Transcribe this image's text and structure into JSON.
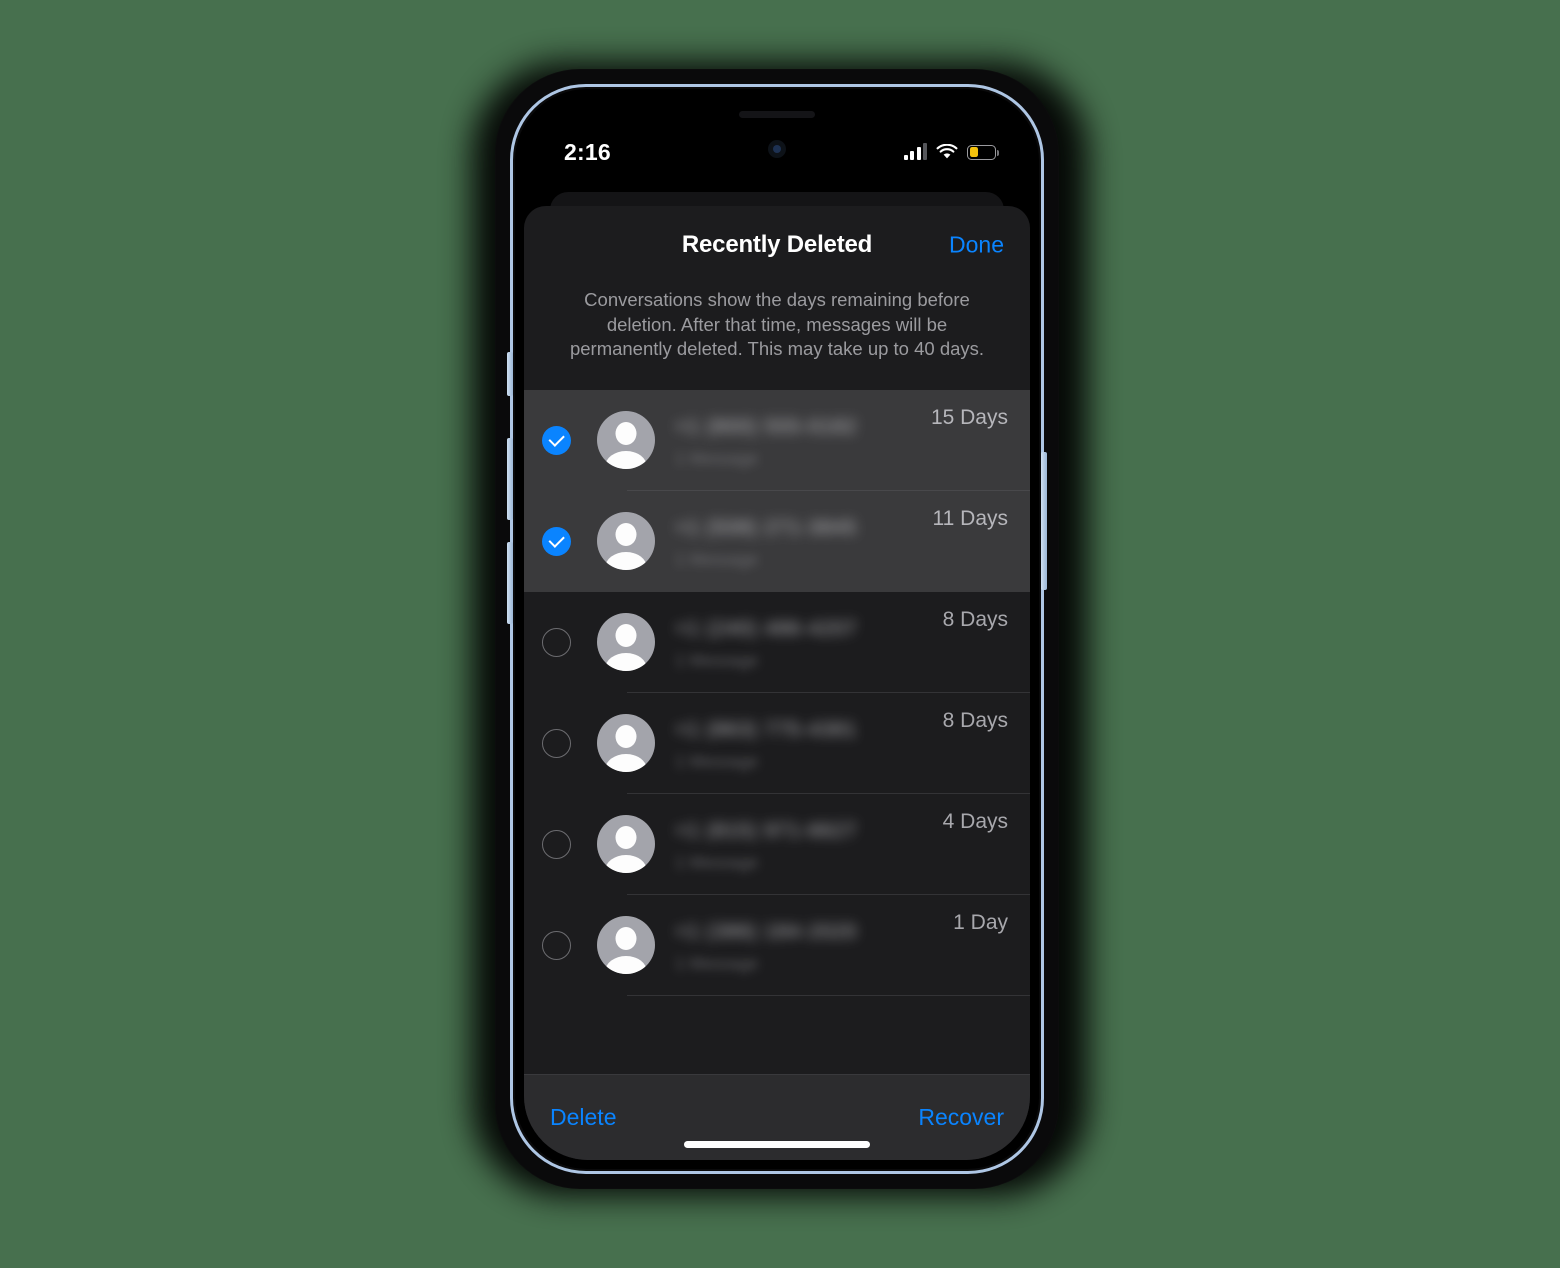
{
  "background_color": "#47704e",
  "accent_color": "#0a84ff",
  "device": {
    "frame_color": "#aec6e4",
    "buttons": [
      "mute-switch",
      "volume-up",
      "volume-down",
      "power"
    ]
  },
  "status_bar": {
    "time": "2:16",
    "signal_bars_filled": 3,
    "signal_bars_total": 4,
    "wifi": "wifi-icon",
    "battery_percent": 35,
    "battery_color": "#f4c20d"
  },
  "sheet": {
    "title": "Recently Deleted",
    "done_label": "Done",
    "description": "Conversations show the days remaining before deletion. After that time, messages will be permanently deleted. This may take up to 40 days."
  },
  "list": {
    "rows": [
      {
        "selected": true,
        "name": "+1 (800) 555-0182",
        "subtitle": "1 Message",
        "days": "15 Days"
      },
      {
        "selected": true,
        "name": "+1 (508) 271-3845",
        "subtitle": "1 Message",
        "days": "11 Days"
      },
      {
        "selected": false,
        "name": "+1 (240) 486-4207",
        "subtitle": "1 Message",
        "days": "8 Days"
      },
      {
        "selected": false,
        "name": "+1 (863) 775-4381",
        "subtitle": "1 Message",
        "days": "8 Days"
      },
      {
        "selected": false,
        "name": "+1 (815) 971-6627",
        "subtitle": "1 Message",
        "days": "4 Days"
      },
      {
        "selected": false,
        "name": "+1 (386) 184-2020",
        "subtitle": "1 Message",
        "days": "1 Day"
      }
    ]
  },
  "toolbar": {
    "delete_label": "Delete",
    "recover_label": "Recover"
  }
}
